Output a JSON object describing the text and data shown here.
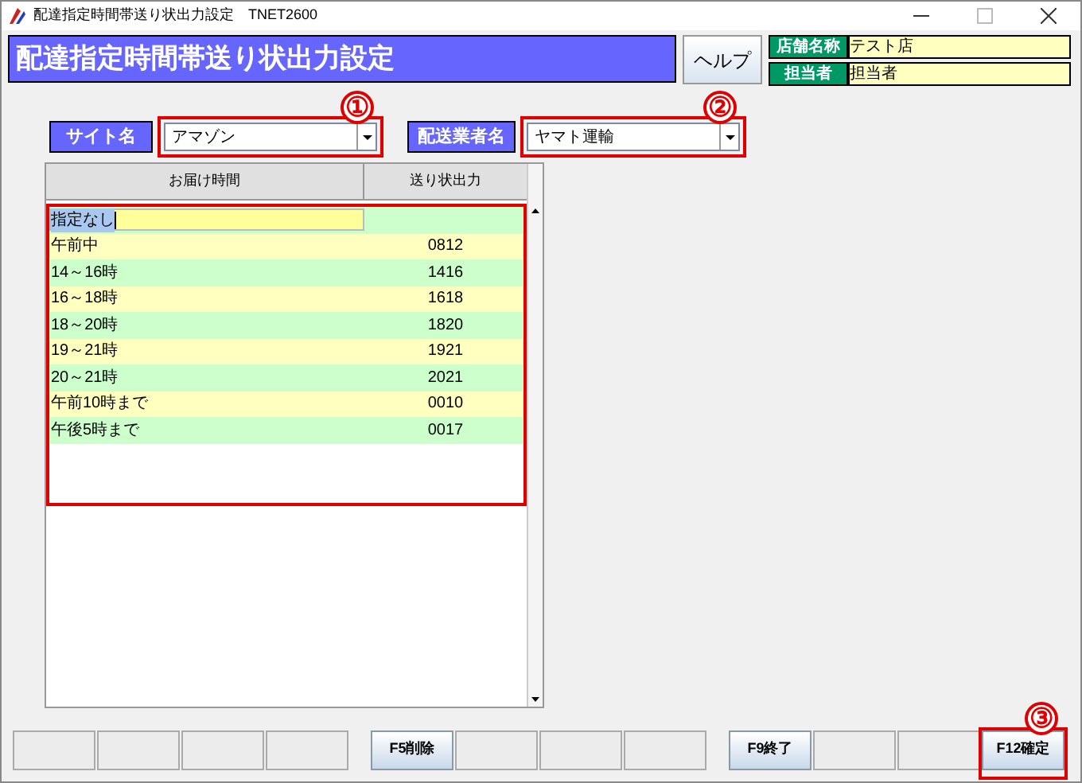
{
  "window": {
    "title": "配達指定時間帯送り状出力設定　TNET2600"
  },
  "header": {
    "title": "配達指定時間帯送り状出力設定",
    "help_button": "ヘルプ",
    "info": [
      {
        "label": "店舗名称",
        "value": "テスト店"
      },
      {
        "label": "担当者",
        "value": "担当者"
      }
    ]
  },
  "filters": [
    {
      "label": "サイト名",
      "value": "アマゾン",
      "callout": "①"
    },
    {
      "label": "配送業者名",
      "value": "ヤマト運輸",
      "callout": "②"
    }
  ],
  "table": {
    "columns": [
      "お届け時間",
      "送り状出力"
    ],
    "rows": [
      {
        "cells": [
          "指定なし",
          ""
        ],
        "selected": true
      },
      {
        "cells": [
          "午前中",
          "0812"
        ],
        "selected": false
      },
      {
        "cells": [
          "14～16時",
          "1416"
        ],
        "selected": false
      },
      {
        "cells": [
          "16～18時",
          "1618"
        ],
        "selected": false
      },
      {
        "cells": [
          "18～20時",
          "1820"
        ],
        "selected": false
      },
      {
        "cells": [
          "19～21時",
          "1921"
        ],
        "selected": false
      },
      {
        "cells": [
          "20～21時",
          "2021"
        ],
        "selected": false
      },
      {
        "cells": [
          "午前10時まで",
          "0010"
        ],
        "selected": false
      },
      {
        "cells": [
          "午後5時まで",
          "0017"
        ],
        "selected": false
      }
    ]
  },
  "function_keys": [
    [
      {
        "kind": "blank"
      },
      {
        "kind": "blank"
      },
      {
        "kind": "blank"
      },
      {
        "kind": "blank"
      }
    ],
    [
      {
        "kind": "key",
        "label": "F5削除"
      },
      {
        "kind": "blank"
      },
      {
        "kind": "blank"
      },
      {
        "kind": "blank"
      }
    ],
    [
      {
        "kind": "key",
        "label": "F9終了"
      },
      {
        "kind": "blank"
      },
      {
        "kind": "blank"
      },
      {
        "kind": "key",
        "label": "F12確定",
        "callout": "③"
      }
    ]
  ]
}
